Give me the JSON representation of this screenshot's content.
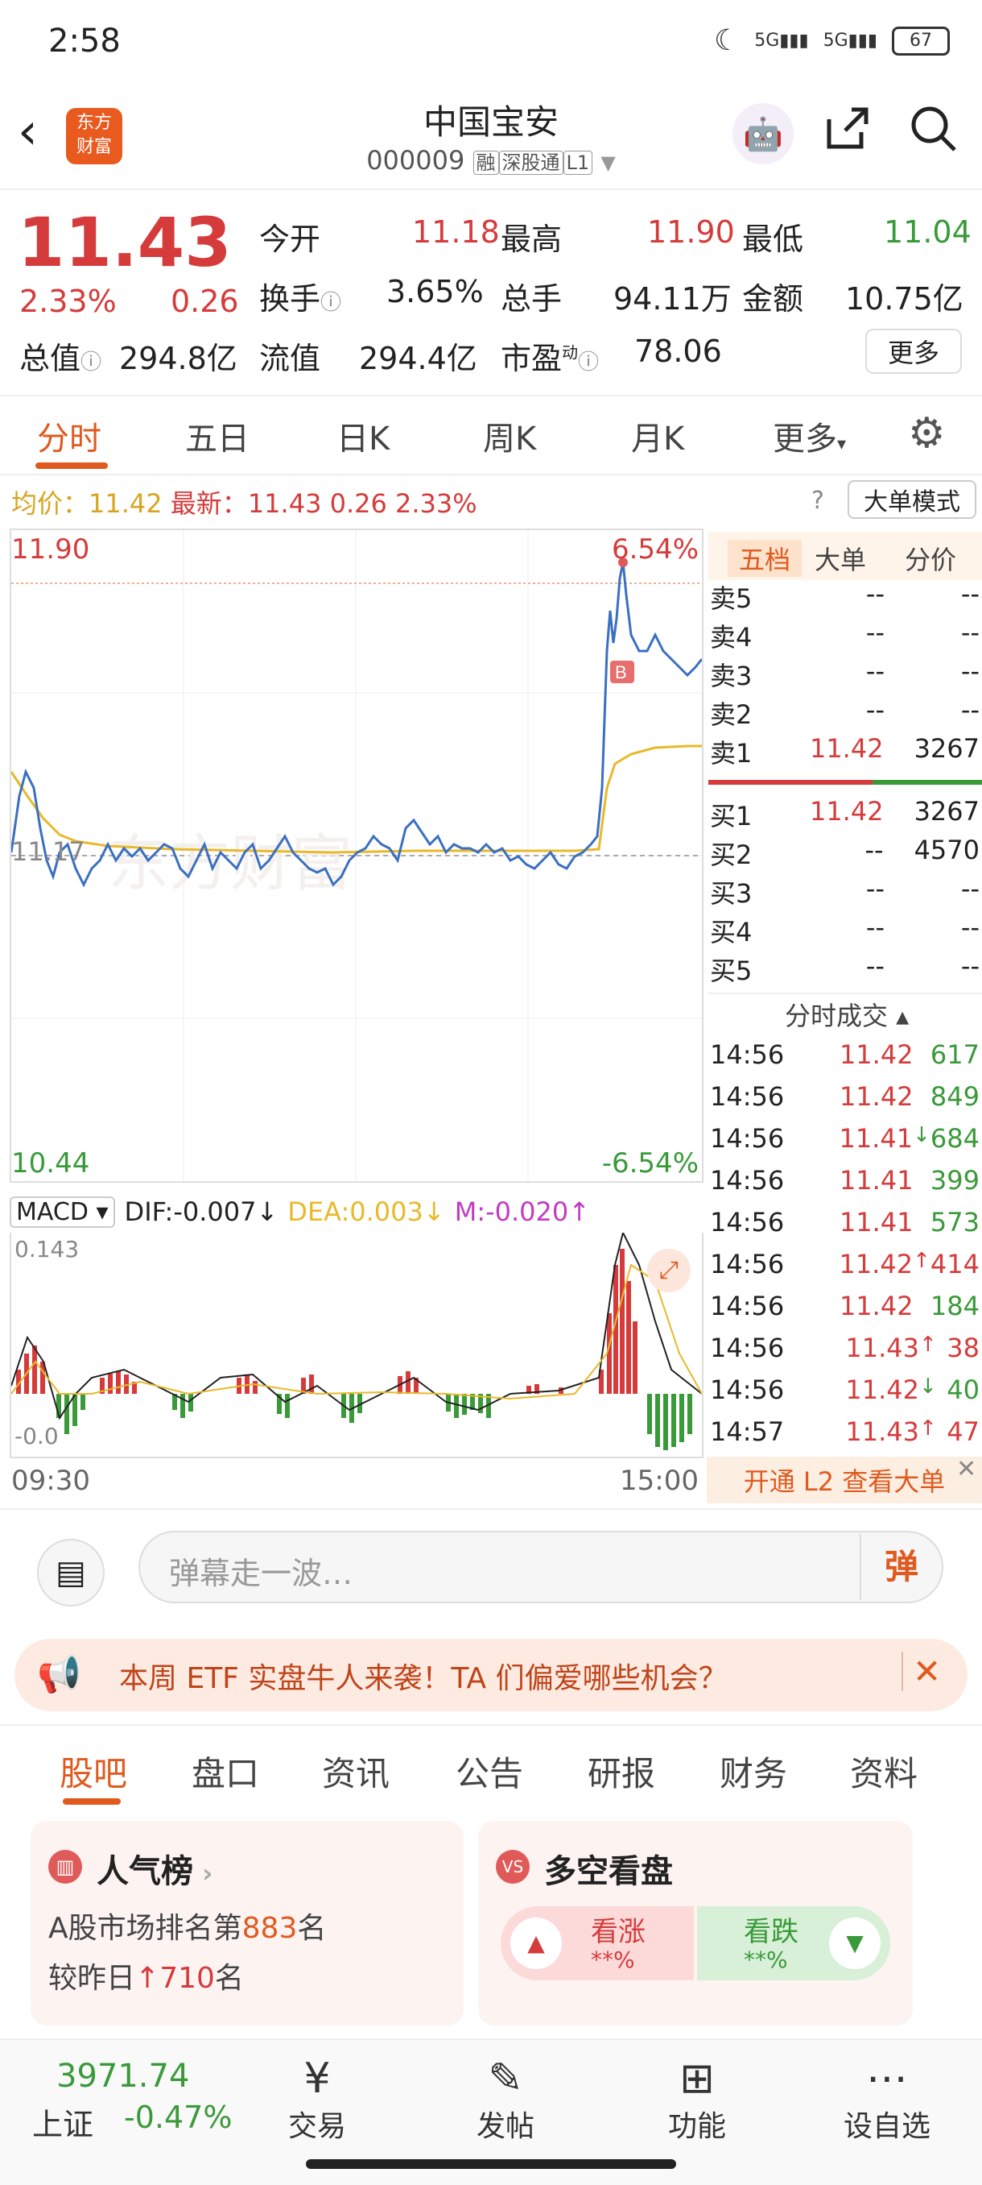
{
  "status": {
    "time": "2:58",
    "signal1": "5G",
    "signal2": "5G",
    "battery": "67"
  },
  "header": {
    "logo_line1": "东方",
    "logo_line2": "财富",
    "title": "中国宝安",
    "code": "000009",
    "tags": [
      "融",
      "深股通",
      "L1"
    ]
  },
  "quote": {
    "price": "11.43",
    "change_pct": "2.33%",
    "change": "0.26",
    "open_label": "今开",
    "open": "11.18",
    "high_label": "最高",
    "high": "11.90",
    "low_label": "最低",
    "low": "11.04",
    "turnover_label": "换手",
    "turnover": "3.65%",
    "volume_label": "总手",
    "volume": "94.11万",
    "amount_label": "金额",
    "amount": "10.75亿",
    "mcap_label": "总值",
    "mcap": "294.8亿",
    "float_label": "流值",
    "float": "294.4亿",
    "pe_label": "市盈",
    "pe_sup": "动",
    "pe": "78.06",
    "more": "更多"
  },
  "tabs": [
    "分时",
    "五日",
    "日K",
    "周K",
    "月K",
    "更多"
  ],
  "avgline": {
    "avg_label": "均价：",
    "avg": "11.42",
    "latest_label": "最新：",
    "latest": "11.43",
    "chg": "0.26",
    "pct": "2.33%"
  },
  "bigmode": "大单模式",
  "chart": {
    "y_top": "11.90",
    "y_top_pct": "6.54%",
    "y_mid": "11.17",
    "y_bot": "10.44",
    "y_bot_pct": "-6.54%",
    "watermark": "东方财富",
    "marker": "B",
    "macd_top": "0.143",
    "macd_bot": "-0.0",
    "t_start": "09:30",
    "t_end": "15:00"
  },
  "macd": {
    "label": "MACD",
    "dif": "DIF:-0.007↓",
    "dea": "DEA:0.003↓",
    "m": "M:-0.020↑"
  },
  "side_tabs": [
    "五档",
    "大单",
    "分价"
  ],
  "asks": [
    {
      "label": "卖5",
      "price": "--",
      "vol": "--"
    },
    {
      "label": "卖4",
      "price": "--",
      "vol": "--"
    },
    {
      "label": "卖3",
      "price": "--",
      "vol": "--"
    },
    {
      "label": "卖2",
      "price": "--",
      "vol": "--"
    },
    {
      "label": "卖1",
      "price": "11.42",
      "vol": "3267"
    }
  ],
  "bids": [
    {
      "label": "买1",
      "price": "11.42",
      "vol": "3267"
    },
    {
      "label": "买2",
      "price": "--",
      "vol": "4570"
    },
    {
      "label": "买3",
      "price": "--",
      "vol": "--"
    },
    {
      "label": "买4",
      "price": "--",
      "vol": "--"
    },
    {
      "label": "买5",
      "price": "--",
      "vol": "--"
    }
  ],
  "trades_title": "分时成交 ▴",
  "trades": [
    {
      "t": "14:56",
      "p": "11.42",
      "a": "",
      "v": "617",
      "pc": "red",
      "vc": "green"
    },
    {
      "t": "14:56",
      "p": "11.42",
      "a": "",
      "v": "849",
      "pc": "red",
      "vc": "green"
    },
    {
      "t": "14:56",
      "p": "11.41",
      "a": "↓",
      "v": "684",
      "pc": "red",
      "vc": "green"
    },
    {
      "t": "14:56",
      "p": "11.41",
      "a": "",
      "v": "399",
      "pc": "red",
      "vc": "green"
    },
    {
      "t": "14:56",
      "p": "11.41",
      "a": "",
      "v": "573",
      "pc": "red",
      "vc": "green"
    },
    {
      "t": "14:56",
      "p": "11.42",
      "a": "↑",
      "v": "414",
      "pc": "red",
      "vc": "red"
    },
    {
      "t": "14:56",
      "p": "11.42",
      "a": "",
      "v": "184",
      "pc": "red",
      "vc": "green"
    },
    {
      "t": "14:56",
      "p": "11.43",
      "a": "↑",
      "v": "38",
      "pc": "red",
      "vc": "red"
    },
    {
      "t": "14:56",
      "p": "11.42",
      "a": "↓",
      "v": "40",
      "pc": "red",
      "vc": "green"
    },
    {
      "t": "14:57",
      "p": "11.43",
      "a": "↑",
      "v": "47",
      "pc": "red",
      "vc": "red"
    }
  ],
  "l2": "开通 L2 查看大单",
  "danmu": {
    "placeholder": "弹幕走一波…",
    "btn": "弹"
  },
  "notice": "本周 ETF 实盘牛人来袭！TA 们偏爱哪些机会？",
  "content_tabs": [
    "股吧",
    "盘口",
    "资讯",
    "公告",
    "研报",
    "财务",
    "资料"
  ],
  "popularity": {
    "title": "人气榜",
    "rank_prefix": "A股市场排名第",
    "rank": "883",
    "rank_suffix": "名",
    "vs_prefix": "较昨日",
    "vs_arrow": "↑",
    "vs": "710",
    "vs_suffix": "名"
  },
  "sentiment": {
    "title": "多空看盘",
    "bull": "看涨",
    "bull_val": "**%",
    "bear": "看跌",
    "bear_val": "**%"
  },
  "bottom": {
    "index": "3971.74",
    "index_name": "上证",
    "index_pct": "-0.47%",
    "nav": [
      "交易",
      "发帖",
      "功能",
      "设自选"
    ]
  },
  "colors": {
    "up": "#d63b3b",
    "down": "#3a9a3a",
    "accent": "#e05a1f",
    "price_line": "#3a6fc2",
    "avg_line": "#e8b92a",
    "macd_m": "#c23bc2"
  }
}
